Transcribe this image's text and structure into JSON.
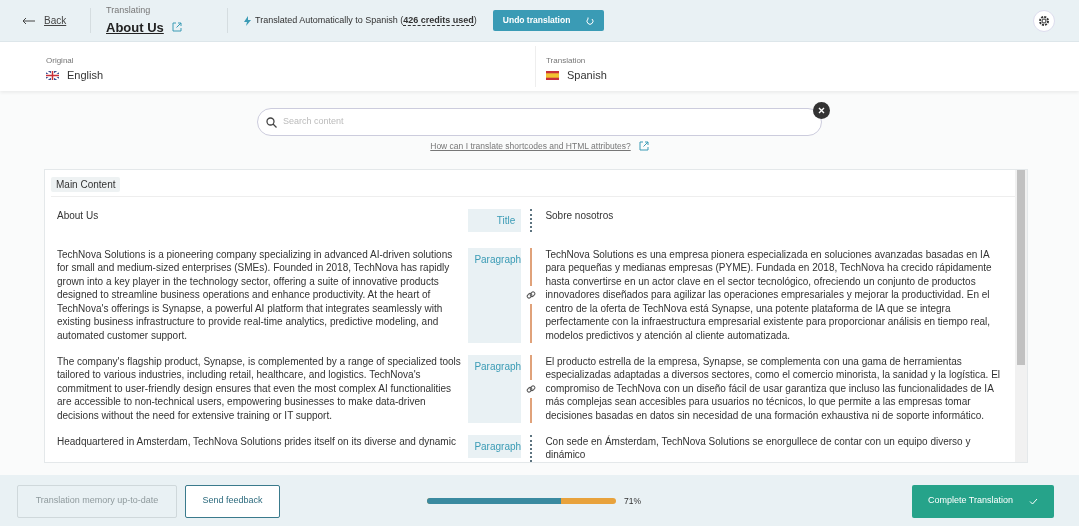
{
  "header": {
    "back": "Back",
    "translating_label": "Translating",
    "page_title": "About Us",
    "status_text": "Translated Automatically to Spanish (",
    "credits": "426 credits used",
    "status_end": ")",
    "undo_button": "Undo translation"
  },
  "languages": {
    "original_label": "Original",
    "original": "English",
    "translation_label": "Translation",
    "translation": "Spanish"
  },
  "search": {
    "placeholder": "Search content",
    "help_link": "How can I translate shortcodes and HTML attributes?"
  },
  "section_label": "Main Content",
  "rows": [
    {
      "original": "About Us",
      "type": "Title",
      "linked": false,
      "translation": "Sobre nosotros"
    },
    {
      "original": "TechNova Solutions is a pioneering company specializing in advanced AI-driven solutions for small and medium-sized enterprises (SMEs). Founded in 2018, TechNova has rapidly grown into a key player in the technology sector, offering a suite of innovative products designed to streamline business operations and enhance productivity. At the heart of TechNova's offerings is Synapse, a powerful AI platform that integrates seamlessly with existing business infrastructure to provide real-time analytics, predictive modeling, and automated customer support.",
      "type": "Paragraph",
      "linked": true,
      "translation": "TechNova Solutions es una empresa pionera especializada en soluciones avanzadas basadas en IA para pequeñas y medianas empresas (PYME). Fundada en 2018, TechNova ha crecido rápidamente hasta convertirse en un actor clave en el sector tecnológico, ofreciendo un conjunto de productos innovadores diseñados para agilizar las operaciones empresariales y mejorar la productividad. En el centro de la oferta de TechNova está Synapse, una potente plataforma de IA que se integra perfectamente con la infraestructura empresarial existente para proporcionar análisis en tiempo real, modelos predictivos y atención al cliente automatizada."
    },
    {
      "original": "The company's flagship product, Synapse, is complemented by a range of specialized tools tailored to various industries, including retail, healthcare, and logistics. TechNova's commitment to user-friendly design ensures that even the most complex AI functionalities are accessible to non-technical users, empowering businesses to make data-driven decisions without the need for extensive training or IT support.",
      "type": "Paragraph",
      "linked": true,
      "translation": "El producto estrella de la empresa, Synapse, se complementa con una gama de herramientas especializadas adaptadas a diversos sectores, como el comercio minorista, la sanidad y la logística. El compromiso de TechNova con un diseño fácil de usar garantiza que incluso las funcionalidades de IA más complejas sean accesibles para usuarios no técnicos, lo que permite a las empresas tomar decisiones basadas en datos sin necesidad de una formación exhaustiva ni de soporte informático."
    },
    {
      "original": "Headquartered in Amsterdam, TechNova Solutions prides itself on its diverse and dynamic",
      "type": "Paragraph",
      "linked": false,
      "translation": "Con sede en Ámsterdam, TechNova Solutions se enorgullece de contar con un equipo diverso y dinámico"
    }
  ],
  "footer": {
    "memory_button": "Translation memory up-to-date",
    "memory_disabled": true,
    "feedback_button": "Send feedback",
    "progress": {
      "level": 0.71,
      "reading": "71%"
    },
    "complete_button": "Complete Translation"
  }
}
